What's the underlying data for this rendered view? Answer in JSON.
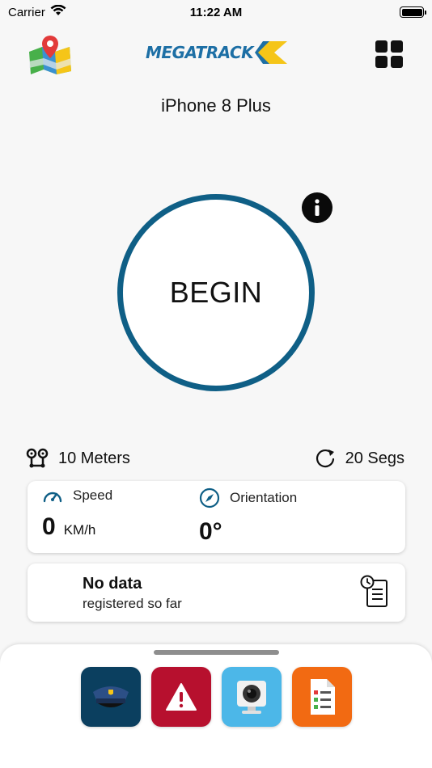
{
  "status_bar": {
    "carrier": "Carrier",
    "time": "11:22 AM"
  },
  "header": {
    "logo_text": "MEGATRACK",
    "device_name": "iPhone 8 Plus"
  },
  "begin_button": {
    "label": "BEGIN"
  },
  "stats": {
    "distance": "10 Meters",
    "segments": "20 Segs"
  },
  "metrics": {
    "speed": {
      "label": "Speed",
      "value": "0",
      "unit": "KM/h"
    },
    "orientation": {
      "label": "Orientation",
      "value": "0°"
    }
  },
  "data_card": {
    "title": "No data",
    "subtitle": "registered so far"
  },
  "bottom_apps": [
    {
      "name": "police-cap-icon",
      "color": "#0b3f5f"
    },
    {
      "name": "alert-icon",
      "color": "#b7102e"
    },
    {
      "name": "camera-icon",
      "color": "#4cb7e8"
    },
    {
      "name": "checklist-icon",
      "color": "#f26a12"
    }
  ],
  "colors": {
    "ring": "#0f5f86",
    "logo_blue": "#1d6fa5",
    "logo_yellow": "#f5c518"
  }
}
